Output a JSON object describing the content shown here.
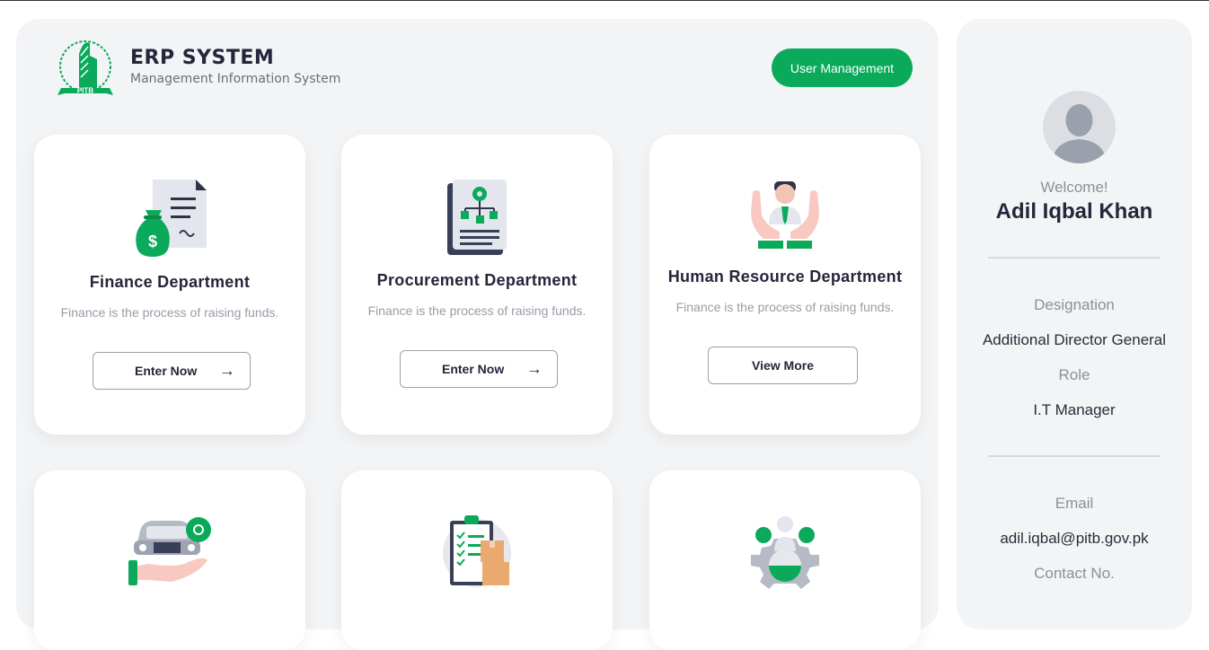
{
  "brand": {
    "title": "ERP SYSTEM",
    "subtitle": "Management Information System",
    "logo_text": "PITB",
    "accent": "#0aaa5a"
  },
  "header": {
    "user_management_label": "User Management"
  },
  "cards": [
    {
      "title": "Finance Department",
      "desc": "Finance is the process of raising funds.",
      "button": "Enter Now",
      "icon": "money-document-icon"
    },
    {
      "title": "Procurement Department",
      "desc": "Finance is the process of raising funds.",
      "button": "Enter Now",
      "icon": "procurement-flow-icon"
    },
    {
      "title": "Human Resource Department",
      "desc": "Finance is the process of raising funds.",
      "button": "View More",
      "icon": "hr-hands-person-icon"
    },
    {
      "icon": "car-service-icon"
    },
    {
      "icon": "checklist-boxes-icon"
    },
    {
      "icon": "team-gear-icon"
    }
  ],
  "profile": {
    "welcome": "Welcome!",
    "name": "Adil Iqbal Khan",
    "designation_label": "Designation",
    "designation": "Additional Director General",
    "role_label": "Role",
    "role": "I.T Manager",
    "email_label": "Email",
    "email": "adil.iqbal@pitb.gov.pk",
    "contact_label": "Contact No."
  }
}
